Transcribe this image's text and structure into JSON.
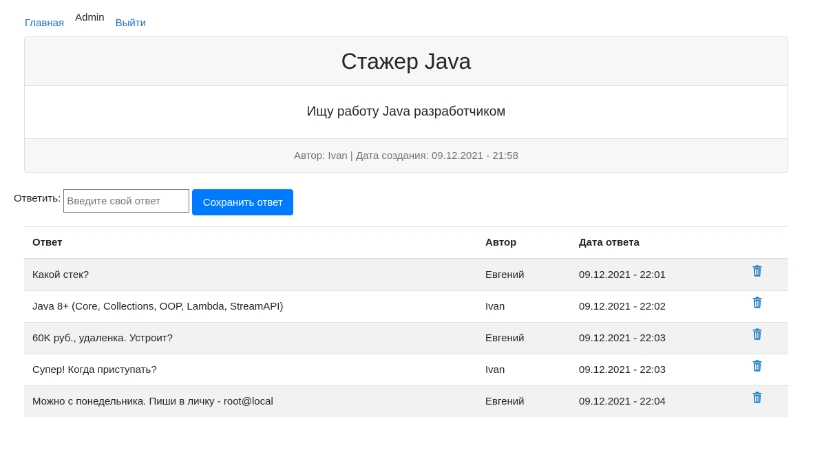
{
  "nav": {
    "home_label": "Главная",
    "user_label": "Admin",
    "logout_label": "Выйти"
  },
  "post": {
    "title": "Стажер Java",
    "description": "Ищу работу Java разработчиком",
    "meta": "Автор: Ivan | Дата создания: 09.12.2021 - 21:58"
  },
  "reply": {
    "label": "Ответить:",
    "placeholder": "Введите свой ответ",
    "submit_label": "Сохранить ответ"
  },
  "table": {
    "headers": {
      "answer": "Ответ",
      "author": "Автор",
      "date": "Дата ответа"
    },
    "rows": [
      {
        "answer": "Какой стек?",
        "author": "Евгений",
        "date": "09.12.2021 - 22:01"
      },
      {
        "answer": "Java 8+ (Core, Collections, OOP, Lambda, StreamAPI)",
        "author": "Ivan",
        "date": "09.12.2021 - 22:02"
      },
      {
        "answer": "60K руб., удаленка. Устроит?",
        "author": "Евгений",
        "date": "09.12.2021 - 22:03"
      },
      {
        "answer": "Супер! Когда приступать?",
        "author": "Ivan",
        "date": "09.12.2021 - 22:03"
      },
      {
        "answer": "Можно с понедельника. Пиши в личку - root@local",
        "author": "Евгений",
        "date": "09.12.2021 - 22:04"
      }
    ],
    "row_action_icon": "trash-icon"
  },
  "colors": {
    "link": "#1a73c8",
    "primary": "#007bff",
    "icon": "#1a7ec8",
    "muted": "#6c757d"
  }
}
